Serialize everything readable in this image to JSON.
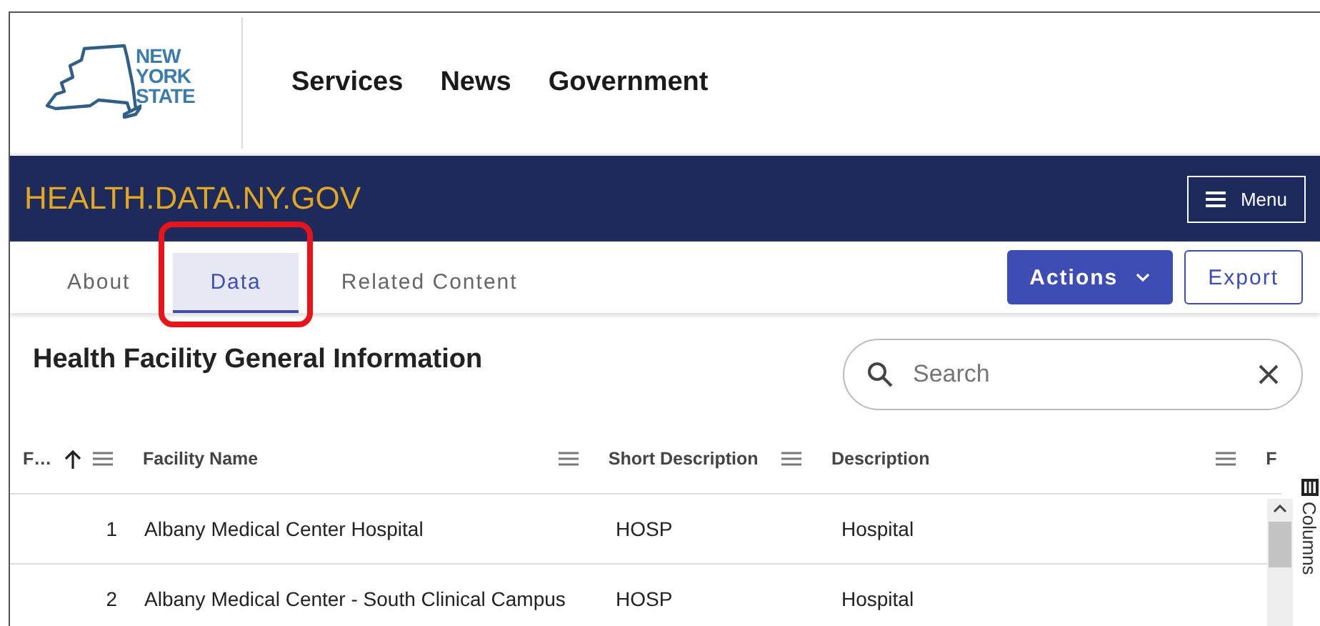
{
  "header": {
    "logo_text": [
      "NEW",
      "YORK",
      "STATE"
    ],
    "nav": [
      "Services",
      "News",
      "Government"
    ]
  },
  "site_bar": {
    "title": "HEALTH.DATA.NY.GOV",
    "menu_button": "Menu"
  },
  "tabs": [
    {
      "label": "About",
      "selected": false,
      "highlighted": false
    },
    {
      "label": "Data",
      "selected": true,
      "highlighted": true
    },
    {
      "label": "Related Content",
      "selected": false,
      "highlighted": false
    }
  ],
  "actions_button": "Actions",
  "export_button": "Export",
  "dataset_title": "Health Facility General Information",
  "search": {
    "placeholder": "Search"
  },
  "table": {
    "columns": [
      {
        "label": "F…",
        "sorted": true,
        "menu": true
      },
      {
        "label": "Facility Name",
        "sorted": false,
        "menu": true
      },
      {
        "label": "Short Description",
        "sorted": false,
        "menu": true
      },
      {
        "label": "Description",
        "sorted": false,
        "menu": true
      },
      {
        "label": "F",
        "sorted": false,
        "menu": false
      }
    ],
    "rows": [
      [
        "1",
        "Albany Medical Center Hospital",
        "HOSP",
        "Hospital"
      ],
      [
        "2",
        "Albany Medical Center - South Clinical Campus",
        "HOSP",
        "Hospital"
      ]
    ]
  },
  "side_panel_label": "Columns"
}
